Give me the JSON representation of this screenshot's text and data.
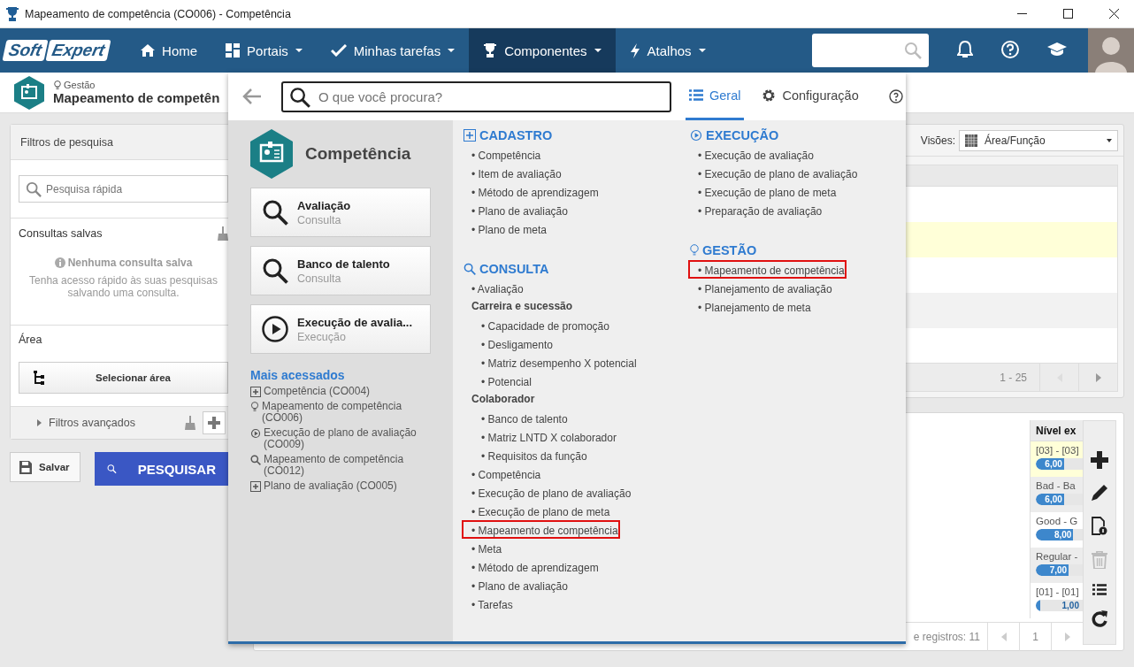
{
  "window": {
    "title": "Mapeamento de competência (CO006) - Competência"
  },
  "nav": {
    "logo": [
      "Soft",
      "Expert"
    ],
    "items": [
      {
        "label": "Home",
        "kind": "home",
        "dropdown": false,
        "selected": false
      },
      {
        "label": "Portais",
        "kind": "grid",
        "dropdown": true,
        "selected": false
      },
      {
        "label": "Minhas tarefas",
        "kind": "check",
        "dropdown": true,
        "selected": false
      },
      {
        "label": "Componentes",
        "kind": "trophy",
        "dropdown": true,
        "selected": true
      },
      {
        "label": "Atalhos",
        "kind": "bolt",
        "dropdown": true,
        "selected": false
      }
    ]
  },
  "page_header": {
    "breadcrumb": "Gestão",
    "title": "Mapeamento de competên"
  },
  "filters": {
    "title": "Filtros de pesquisa",
    "search_placeholder": "Pesquisa rápida",
    "saved_title": "Consultas salvas",
    "empty_title": "Nenhuma consulta salva",
    "empty_text": "Tenha acesso rápido às suas pesquisas salvando uma consulta.",
    "area_title": "Área",
    "area_button": "Selecionar área",
    "advanced": "Filtros avançados",
    "save_button": "Salvar",
    "search_button": "PESQUISAR"
  },
  "views": {
    "label": "Visões:",
    "value": "Área/Função",
    "rows": [
      {
        "selected": false
      },
      {
        "selected": true
      },
      {
        "selected": false
      },
      {
        "selected": false
      },
      {
        "selected": false
      }
    ],
    "pager": "1 - 25"
  },
  "grid": {
    "column": "Nível ex",
    "rows": [
      {
        "selected": true,
        "text": "[03] - [03]",
        "reading": "6,00",
        "level": 0.6
      },
      {
        "selected": false,
        "text": "Bad - Ba",
        "reading": "6,00",
        "level": 0.6
      },
      {
        "selected": false,
        "text": "Good - G",
        "reading": "8,00",
        "level": 0.8
      },
      {
        "selected": false,
        "text": "Regular -",
        "reading": "7,00",
        "level": 0.7
      },
      {
        "selected": false,
        "text": "[01] - [01]",
        "reading": "1,00",
        "level": 0.1
      }
    ],
    "footer": "e registros: 11",
    "page": "1"
  },
  "toolbar": [
    {
      "kind": "add",
      "disabled": false
    },
    {
      "kind": "edit",
      "disabled": false
    },
    {
      "kind": "doc-info",
      "disabled": false
    },
    {
      "kind": "trash",
      "disabled": true
    },
    {
      "kind": "list",
      "disabled": false
    },
    {
      "kind": "refresh",
      "disabled": false
    }
  ],
  "menu": {
    "search_placeholder": "O que você procura?",
    "tabs": [
      {
        "label": "Geral",
        "kind": "list",
        "selected": true
      },
      {
        "label": "Configuração",
        "kind": "gear",
        "selected": false
      }
    ],
    "component": "Competência",
    "cards": [
      {
        "title": "Avaliação",
        "subtitle": "Consulta",
        "kind": "search"
      },
      {
        "title": "Banco de talento",
        "subtitle": "Consulta",
        "kind": "search"
      },
      {
        "title": "Execução de avalia...",
        "subtitle": "Execução",
        "kind": "play"
      }
    ],
    "recent_title": "Mais acessados",
    "recent": [
      {
        "label": "Competência (CO004)",
        "kind": "plus"
      },
      {
        "label": "Mapeamento de competência (CO006)",
        "kind": "bulb"
      },
      {
        "label": "Execução de plano de avaliação (CO009)",
        "kind": "play"
      },
      {
        "label": "Mapeamento de competência (CO012)",
        "kind": "search"
      },
      {
        "label": "Plano de avaliação (CO005)",
        "kind": "plus"
      }
    ],
    "columns": [
      [
        {
          "title": "CADASTRO",
          "kind": "plus",
          "items": [
            {
              "label": "• Competência",
              "highlighted": false
            },
            {
              "label": "• Item de avaliação",
              "highlighted": false
            },
            {
              "label": "• Método de aprendizagem",
              "highlighted": false
            },
            {
              "label": "• Plano de avaliação",
              "highlighted": false
            },
            {
              "label": "• Plano de meta",
              "highlighted": false
            }
          ]
        },
        {
          "title": "CONSULTA",
          "kind": "search",
          "items": [
            {
              "label": "• Avaliação",
              "highlighted": false
            },
            {
              "label": "Carreira e sucessão",
              "children": [
                {
                  "label": "• Capacidade de promoção",
                  "highlighted": false
                },
                {
                  "label": "• Desligamento",
                  "highlighted": false
                },
                {
                  "label": "• Matriz desempenho X potencial",
                  "highlighted": false
                },
                {
                  "label": "• Potencial",
                  "highlighted": false
                }
              ]
            },
            {
              "label": "Colaborador",
              "children": [
                {
                  "label": "• Banco de talento",
                  "highlighted": false
                },
                {
                  "label": "• Matriz LNTD X colaborador",
                  "highlighted": false
                },
                {
                  "label": "• Requisitos da função",
                  "highlighted": false
                }
              ]
            },
            {
              "label": "• Competência",
              "highlighted": false
            },
            {
              "label": "• Execução de plano de avaliação",
              "highlighted": false
            },
            {
              "label": "• Execução de plano de meta",
              "highlighted": false
            },
            {
              "label": "• Mapeamento de competência",
              "highlighted": true
            },
            {
              "label": "• Meta",
              "highlighted": false
            },
            {
              "label": "• Método de aprendizagem",
              "highlighted": false
            },
            {
              "label": "• Plano de avaliação",
              "highlighted": false
            },
            {
              "label": "• Tarefas",
              "highlighted": false
            }
          ]
        }
      ],
      [
        {
          "title": "EXECUÇÃO",
          "kind": "play",
          "items": [
            {
              "label": "• Execução de avaliação",
              "highlighted": false
            },
            {
              "label": "• Execução de plano de avaliação",
              "highlighted": false
            },
            {
              "label": "• Execução de plano de meta",
              "highlighted": false
            },
            {
              "label": "• Preparação de avaliação",
              "highlighted": false
            }
          ]
        },
        {
          "title": "GESTÃO",
          "kind": "bulb",
          "items": [
            {
              "label": "• Mapeamento de competência",
              "highlighted": true
            },
            {
              "label": "• Planejamento de avaliação",
              "highlighted": false
            },
            {
              "label": "• Planejamento de meta",
              "highlighted": false
            }
          ]
        }
      ]
    ]
  }
}
